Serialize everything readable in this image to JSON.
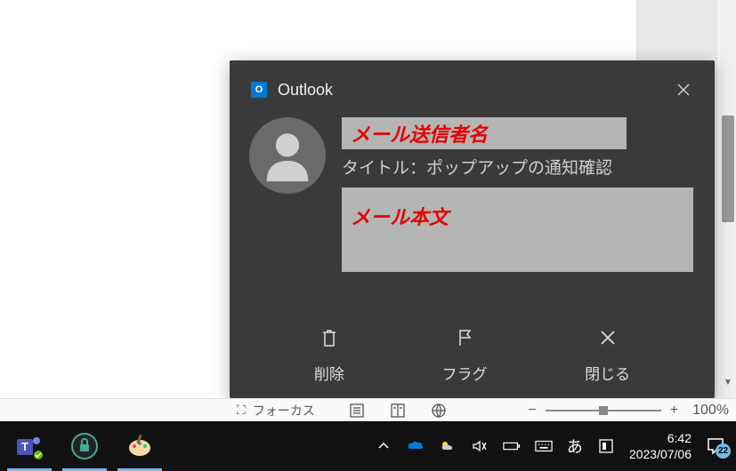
{
  "notification": {
    "app_name": "Outlook",
    "sender_placeholder": "メール送信者名",
    "subject": "タイトル：ポップアップの通知確認",
    "body_placeholder": "メール本文",
    "actions": {
      "delete": "削除",
      "flag": "フラグ",
      "close": "閉じる"
    }
  },
  "status_bar": {
    "focus": "フォーカス",
    "zoom_percent": "100%",
    "minus": "−",
    "plus": "+"
  },
  "taskbar": {
    "ime": "あ",
    "clock_time": "6:42",
    "clock_date": "2023/07/06",
    "notification_count": "22"
  }
}
